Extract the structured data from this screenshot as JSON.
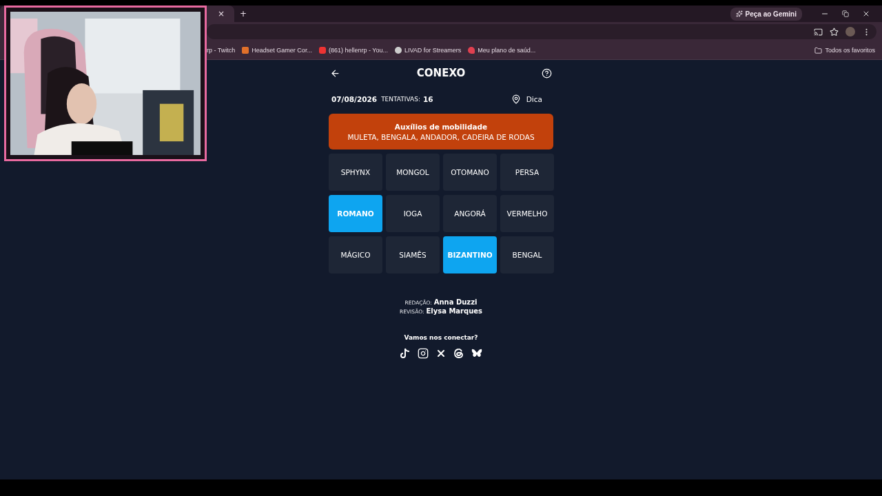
{
  "browser": {
    "tab_close": "×",
    "new_tab": "+",
    "gemini_button": "Peça ao Gemini",
    "bookmarks": [
      {
        "label": "rp - Twitch",
        "kind": "plain"
      },
      {
        "label": "Headset Gamer Cor...",
        "kind": "orange"
      },
      {
        "label": "(861) hellenrp - You...",
        "kind": "youtube"
      },
      {
        "label": "LIVAD for Streamers",
        "kind": "livad"
      },
      {
        "label": "Meu plano de saúd...",
        "kind": "heart"
      }
    ],
    "all_bookmarks": "Todos os favoritos"
  },
  "game": {
    "title": "CONEXO",
    "date": "07/08/2026",
    "attempts_label": "TENTATIVAS:",
    "attempts": "16",
    "hint": "Dica",
    "solved_group": {
      "title": "Auxílios de mobilidade",
      "words": "MULETA, BENGALA, ANDADOR, CADEIRA DE RODAS",
      "color": "#c2410c"
    },
    "tiles": [
      {
        "label": "SPHYNX",
        "selected": false
      },
      {
        "label": "MONGOL",
        "selected": false
      },
      {
        "label": "OTOMANO",
        "selected": false
      },
      {
        "label": "PERSA",
        "selected": false
      },
      {
        "label": "ROMANO",
        "selected": true
      },
      {
        "label": "IOGA",
        "selected": false
      },
      {
        "label": "ANGORÁ",
        "selected": false
      },
      {
        "label": "VERMELHO",
        "selected": false
      },
      {
        "label": "MÁGICO",
        "selected": false
      },
      {
        "label": "SIAMÊS",
        "selected": false
      },
      {
        "label": "BIZANTINO",
        "selected": true
      },
      {
        "label": "BENGAL",
        "selected": false
      }
    ],
    "credits": [
      {
        "role": "REDAÇÃO:",
        "name": "Anna Duzzi"
      },
      {
        "role": "REVISÃO:",
        "name": "Elysa Marques"
      }
    ],
    "connect": "Vamos nos conectar?"
  }
}
